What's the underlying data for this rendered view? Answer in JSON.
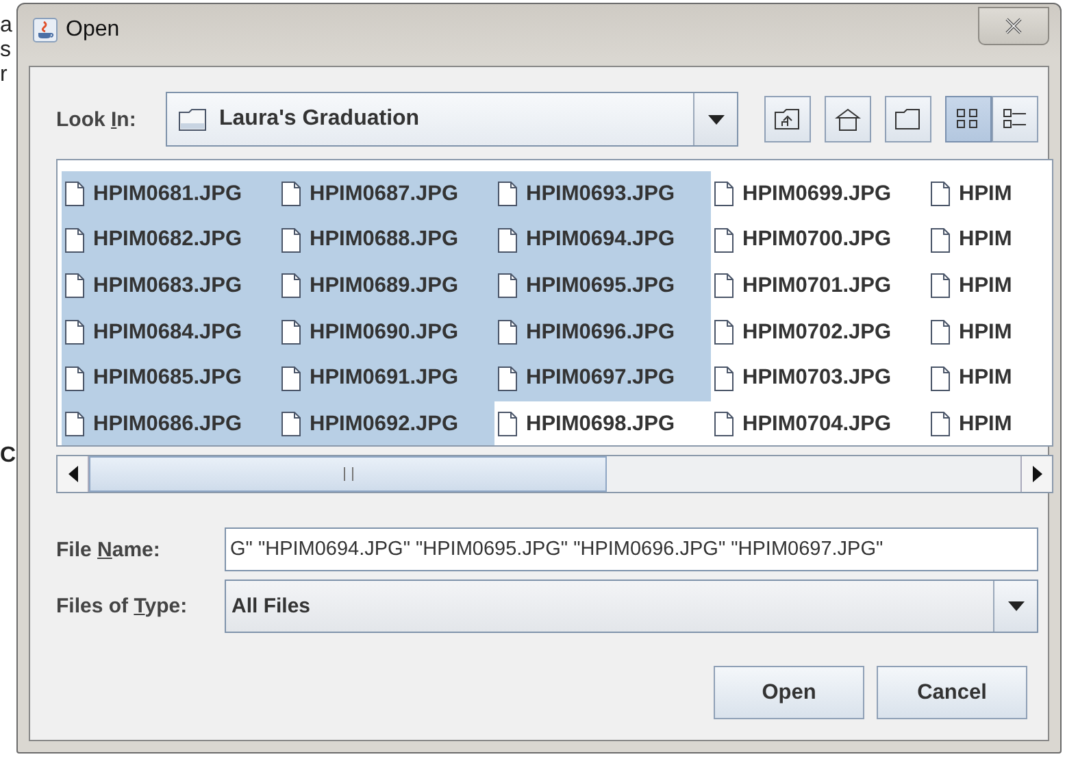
{
  "background_text": [
    "a",
    "s",
    "r",
    "C"
  ],
  "window": {
    "title": "Open"
  },
  "look_in": {
    "label": {
      "before": "Look ",
      "key": "I",
      "after": "n:"
    },
    "value": "Laura's Graduation"
  },
  "view_buttons": [
    {
      "kind": "list",
      "selected": true
    },
    {
      "kind": "details",
      "selected": false
    }
  ],
  "file_columns": [
    {
      "items": [
        {
          "name": "HPIM0681.JPG",
          "selected": true
        },
        {
          "name": "HPIM0682.JPG",
          "selected": true
        },
        {
          "name": "HPIM0683.JPG",
          "selected": true
        },
        {
          "name": "HPIM0684.JPG",
          "selected": true
        },
        {
          "name": "HPIM0685.JPG",
          "selected": true
        },
        {
          "name": "HPIM0686.JPG",
          "selected": true
        }
      ]
    },
    {
      "items": [
        {
          "name": "HPIM0687.JPG",
          "selected": true
        },
        {
          "name": "HPIM0688.JPG",
          "selected": true
        },
        {
          "name": "HPIM0689.JPG",
          "selected": true
        },
        {
          "name": "HPIM0690.JPG",
          "selected": true
        },
        {
          "name": "HPIM0691.JPG",
          "selected": true
        },
        {
          "name": "HPIM0692.JPG",
          "selected": true
        }
      ]
    },
    {
      "items": [
        {
          "name": "HPIM0693.JPG",
          "selected": true
        },
        {
          "name": "HPIM0694.JPG",
          "selected": true
        },
        {
          "name": "HPIM0695.JPG",
          "selected": true
        },
        {
          "name": "HPIM0696.JPG",
          "selected": true
        },
        {
          "name": "HPIM0697.JPG",
          "selected": true
        },
        {
          "name": "HPIM0698.JPG",
          "selected": false
        }
      ]
    },
    {
      "items": [
        {
          "name": "HPIM0699.JPG",
          "selected": false
        },
        {
          "name": "HPIM0700.JPG",
          "selected": false
        },
        {
          "name": "HPIM0701.JPG",
          "selected": false
        },
        {
          "name": "HPIM0702.JPG",
          "selected": false
        },
        {
          "name": "HPIM0703.JPG",
          "selected": false
        },
        {
          "name": "HPIM0704.JPG",
          "selected": false
        }
      ]
    },
    {
      "items": [
        {
          "name": "HPIM",
          "selected": false
        },
        {
          "name": "HPIM",
          "selected": false
        },
        {
          "name": "HPIM",
          "selected": false
        },
        {
          "name": "HPIM",
          "selected": false
        },
        {
          "name": "HPIM",
          "selected": false
        },
        {
          "name": "HPIM",
          "selected": false
        }
      ]
    }
  ],
  "file_name": {
    "label": {
      "before": "File ",
      "key": "N",
      "after": "ame:"
    },
    "value": "G\" \"HPIM0694.JPG\" \"HPIM0695.JPG\" \"HPIM0696.JPG\" \"HPIM0697.JPG\""
  },
  "file_type": {
    "label": {
      "before": "Files of ",
      "key": "T",
      "after": "ype:"
    },
    "value": "All Files"
  },
  "buttons": [
    "Open",
    "Cancel"
  ]
}
